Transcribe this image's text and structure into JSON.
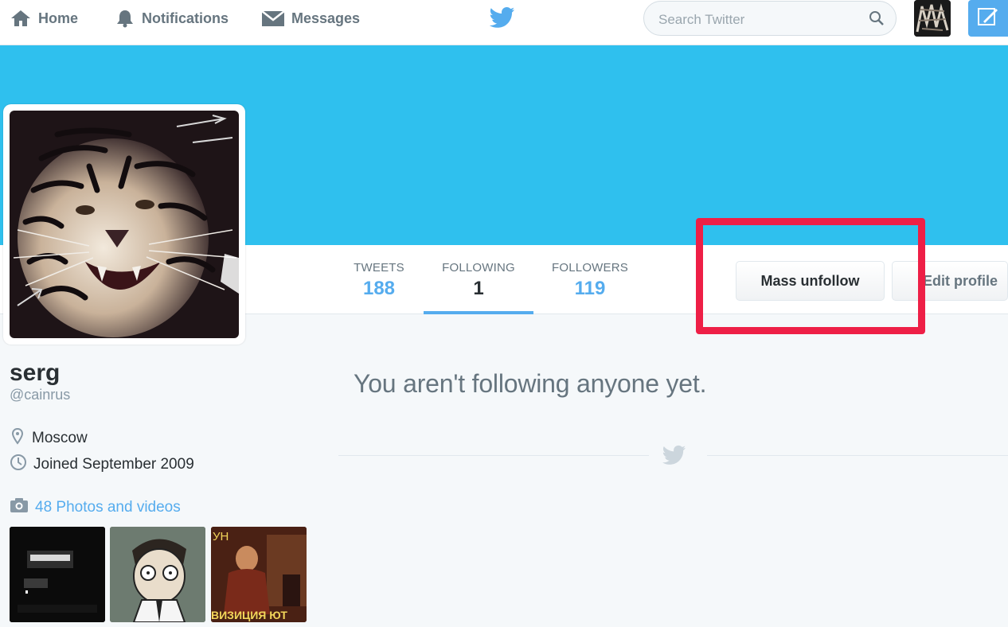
{
  "nav": {
    "home_label": "Home",
    "notifications_label": "Notifications",
    "messages_label": "Messages",
    "search_placeholder": "Search Twitter"
  },
  "profile": {
    "name": "serg",
    "handle": "@cainrus",
    "location": "Moscow",
    "joined": "Joined September 2009",
    "photos_link": "48 Photos and videos"
  },
  "stats": {
    "tweets_label": "TWEETS",
    "tweets_value": "188",
    "following_label": "FOLLOWING",
    "following_value": "1",
    "followers_label": "FOLLOWERS",
    "followers_value": "119"
  },
  "actions": {
    "mass_unfollow_label": "Mass unfollow",
    "edit_profile_label": "Edit profile"
  },
  "main": {
    "empty_message": "You aren't following anyone yet."
  },
  "thumbnails": {
    "thumb3_text_top": "УН",
    "thumb3_text_bottom": "ВИЗИЦИЯ ЮТ"
  },
  "colors": {
    "accent": "#55acee",
    "banner": "#2fc0ee",
    "highlight": "#ee1f46"
  },
  "icons": [
    "home-icon",
    "bell-icon",
    "envelope-icon",
    "twitter-bird-icon",
    "search-icon",
    "compose-icon",
    "location-pin-icon",
    "clock-icon",
    "camera-icon"
  ]
}
